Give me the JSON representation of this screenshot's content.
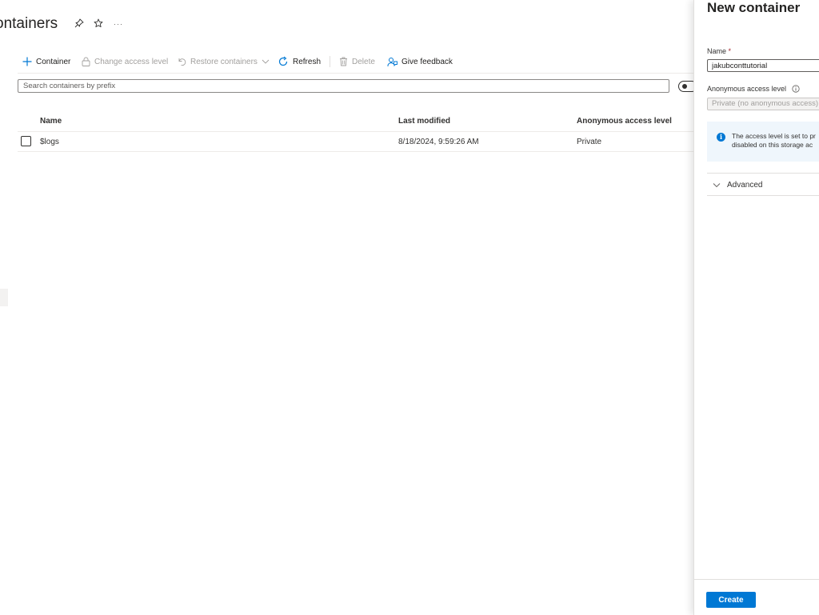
{
  "page": {
    "title": "ontainers",
    "icons": [
      "pin-icon",
      "star-icon",
      "more-icon"
    ],
    "more_glyph": "···"
  },
  "toolbar": {
    "add_container": "Container",
    "change_access_level": "Change access level",
    "restore_containers": "Restore containers",
    "refresh": "Refresh",
    "delete": "Delete",
    "give_feedback": "Give feedback"
  },
  "search": {
    "placeholder": "Search containers by prefix",
    "value": ""
  },
  "table": {
    "columns": [
      "Name",
      "Last modified",
      "Anonymous access level"
    ],
    "rows": [
      {
        "name": "$logs",
        "last_modified": "8/18/2024, 9:59:26 AM",
        "access_level": "Private"
      }
    ]
  },
  "panel": {
    "title": "New container",
    "name_label": "Name",
    "required_marker": "*",
    "name_value": "jakubconttutorial",
    "access_label": "Anonymous access level",
    "access_value": "Private (no anonymous access)",
    "info_line1": "The access level is set to pr",
    "info_line2": "disabled on this storage ac",
    "advanced_label": "Advanced",
    "create_label": "Create"
  },
  "colors": {
    "accent": "#0078d4",
    "text": "#323130",
    "disabled_text": "#a19f9d",
    "info_background": "#eff6fc",
    "required": "#a4262c"
  }
}
